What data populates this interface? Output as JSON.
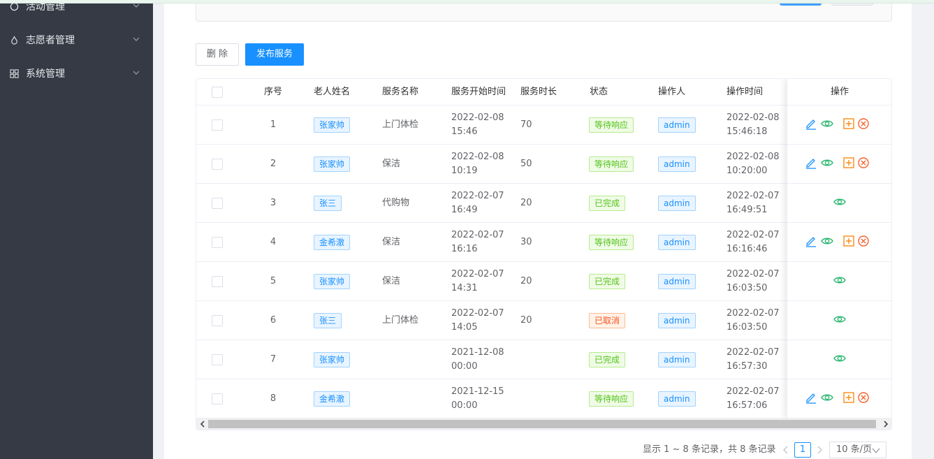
{
  "sidebar": {
    "items": [
      {
        "label": "活动管理",
        "icon": "activity-icon"
      },
      {
        "label": "志愿者管理",
        "icon": "volunteer-icon"
      },
      {
        "label": "系统管理",
        "icon": "system-grid-icon"
      }
    ]
  },
  "toolbar": {
    "delete_label": "删 除",
    "publish_label": "发布服务"
  },
  "table": {
    "headers": {
      "index": "序号",
      "elder_name": "老人姓名",
      "service_name": "服务名称",
      "start_time": "服务开始时间",
      "duration": "服务时长",
      "status": "状态",
      "operator": "操作人",
      "op_time": "操作时间",
      "actions": "操作"
    },
    "rows": [
      {
        "index": "1",
        "elder": "张家帅",
        "service": "上门体检",
        "start_date": "2022-02-08",
        "start_time": "15:46",
        "duration": "70",
        "status": "等待响应",
        "status_type": "green",
        "operator": "admin",
        "op_date": "2022-02-08",
        "op_time": "15:46:18",
        "actions": [
          "edit",
          "view",
          "add",
          "cancel"
        ]
      },
      {
        "index": "2",
        "elder": "张家帅",
        "service": "保洁",
        "start_date": "2022-02-08",
        "start_time": "10:19",
        "duration": "50",
        "status": "等待响应",
        "status_type": "green",
        "operator": "admin",
        "op_date": "2022-02-08",
        "op_time": "10:20:00",
        "actions": [
          "edit",
          "view",
          "add",
          "cancel"
        ]
      },
      {
        "index": "3",
        "elder": "张三",
        "service": "代购物",
        "start_date": "2022-02-07",
        "start_time": "16:49",
        "duration": "20",
        "status": "已完成",
        "status_type": "green",
        "operator": "admin",
        "op_date": "2022-02-07",
        "op_time": "16:49:51",
        "actions": [
          "view"
        ]
      },
      {
        "index": "4",
        "elder": "金希澈",
        "service": "保洁",
        "start_date": "2022-02-07",
        "start_time": "16:16",
        "duration": "30",
        "status": "等待响应",
        "status_type": "green",
        "operator": "admin",
        "op_date": "2022-02-07",
        "op_time": "16:16:46",
        "actions": [
          "edit",
          "view",
          "add",
          "cancel"
        ]
      },
      {
        "index": "5",
        "elder": "张家帅",
        "service": "保洁",
        "start_date": "2022-02-07",
        "start_time": "14:31",
        "duration": "20",
        "status": "已完成",
        "status_type": "green",
        "operator": "admin",
        "op_date": "2022-02-07",
        "op_time": "16:03:50",
        "actions": [
          "view"
        ]
      },
      {
        "index": "6",
        "elder": "张三",
        "service": "上门体检",
        "start_date": "2022-02-07",
        "start_time": "14:05",
        "duration": "20",
        "status": "已取消",
        "status_type": "red",
        "operator": "admin",
        "op_date": "2022-02-07",
        "op_time": "16:03:50",
        "actions": [
          "view"
        ]
      },
      {
        "index": "7",
        "elder": "张家帅",
        "service": "",
        "start_date": "2021-12-08",
        "start_time": "00:00",
        "duration": "",
        "status": "已完成",
        "status_type": "green",
        "operator": "admin",
        "op_date": "2022-02-07",
        "op_time": "16:57:30",
        "actions": [
          "view"
        ]
      },
      {
        "index": "8",
        "elder": "金希澈",
        "service": "",
        "start_date": "2021-12-15",
        "start_time": "00:00",
        "duration": "",
        "status": "等待响应",
        "status_type": "green",
        "operator": "admin",
        "op_date": "2022-02-07",
        "op_time": "16:57:06",
        "actions": [
          "edit",
          "view",
          "add",
          "cancel"
        ]
      }
    ]
  },
  "pagination": {
    "total_text": "显示 1 ~ 8 条记录，共 8 条记录",
    "current_page": "1",
    "page_size": "10 条/页"
  },
  "colors": {
    "sidebar_bg": "#353a45",
    "primary": "#1890ff",
    "success": "#52c41a",
    "danger": "#fa541c",
    "view_icon": "#2eb872",
    "add_icon": "#fa8c16",
    "cancel_icon": "#f5622d"
  }
}
